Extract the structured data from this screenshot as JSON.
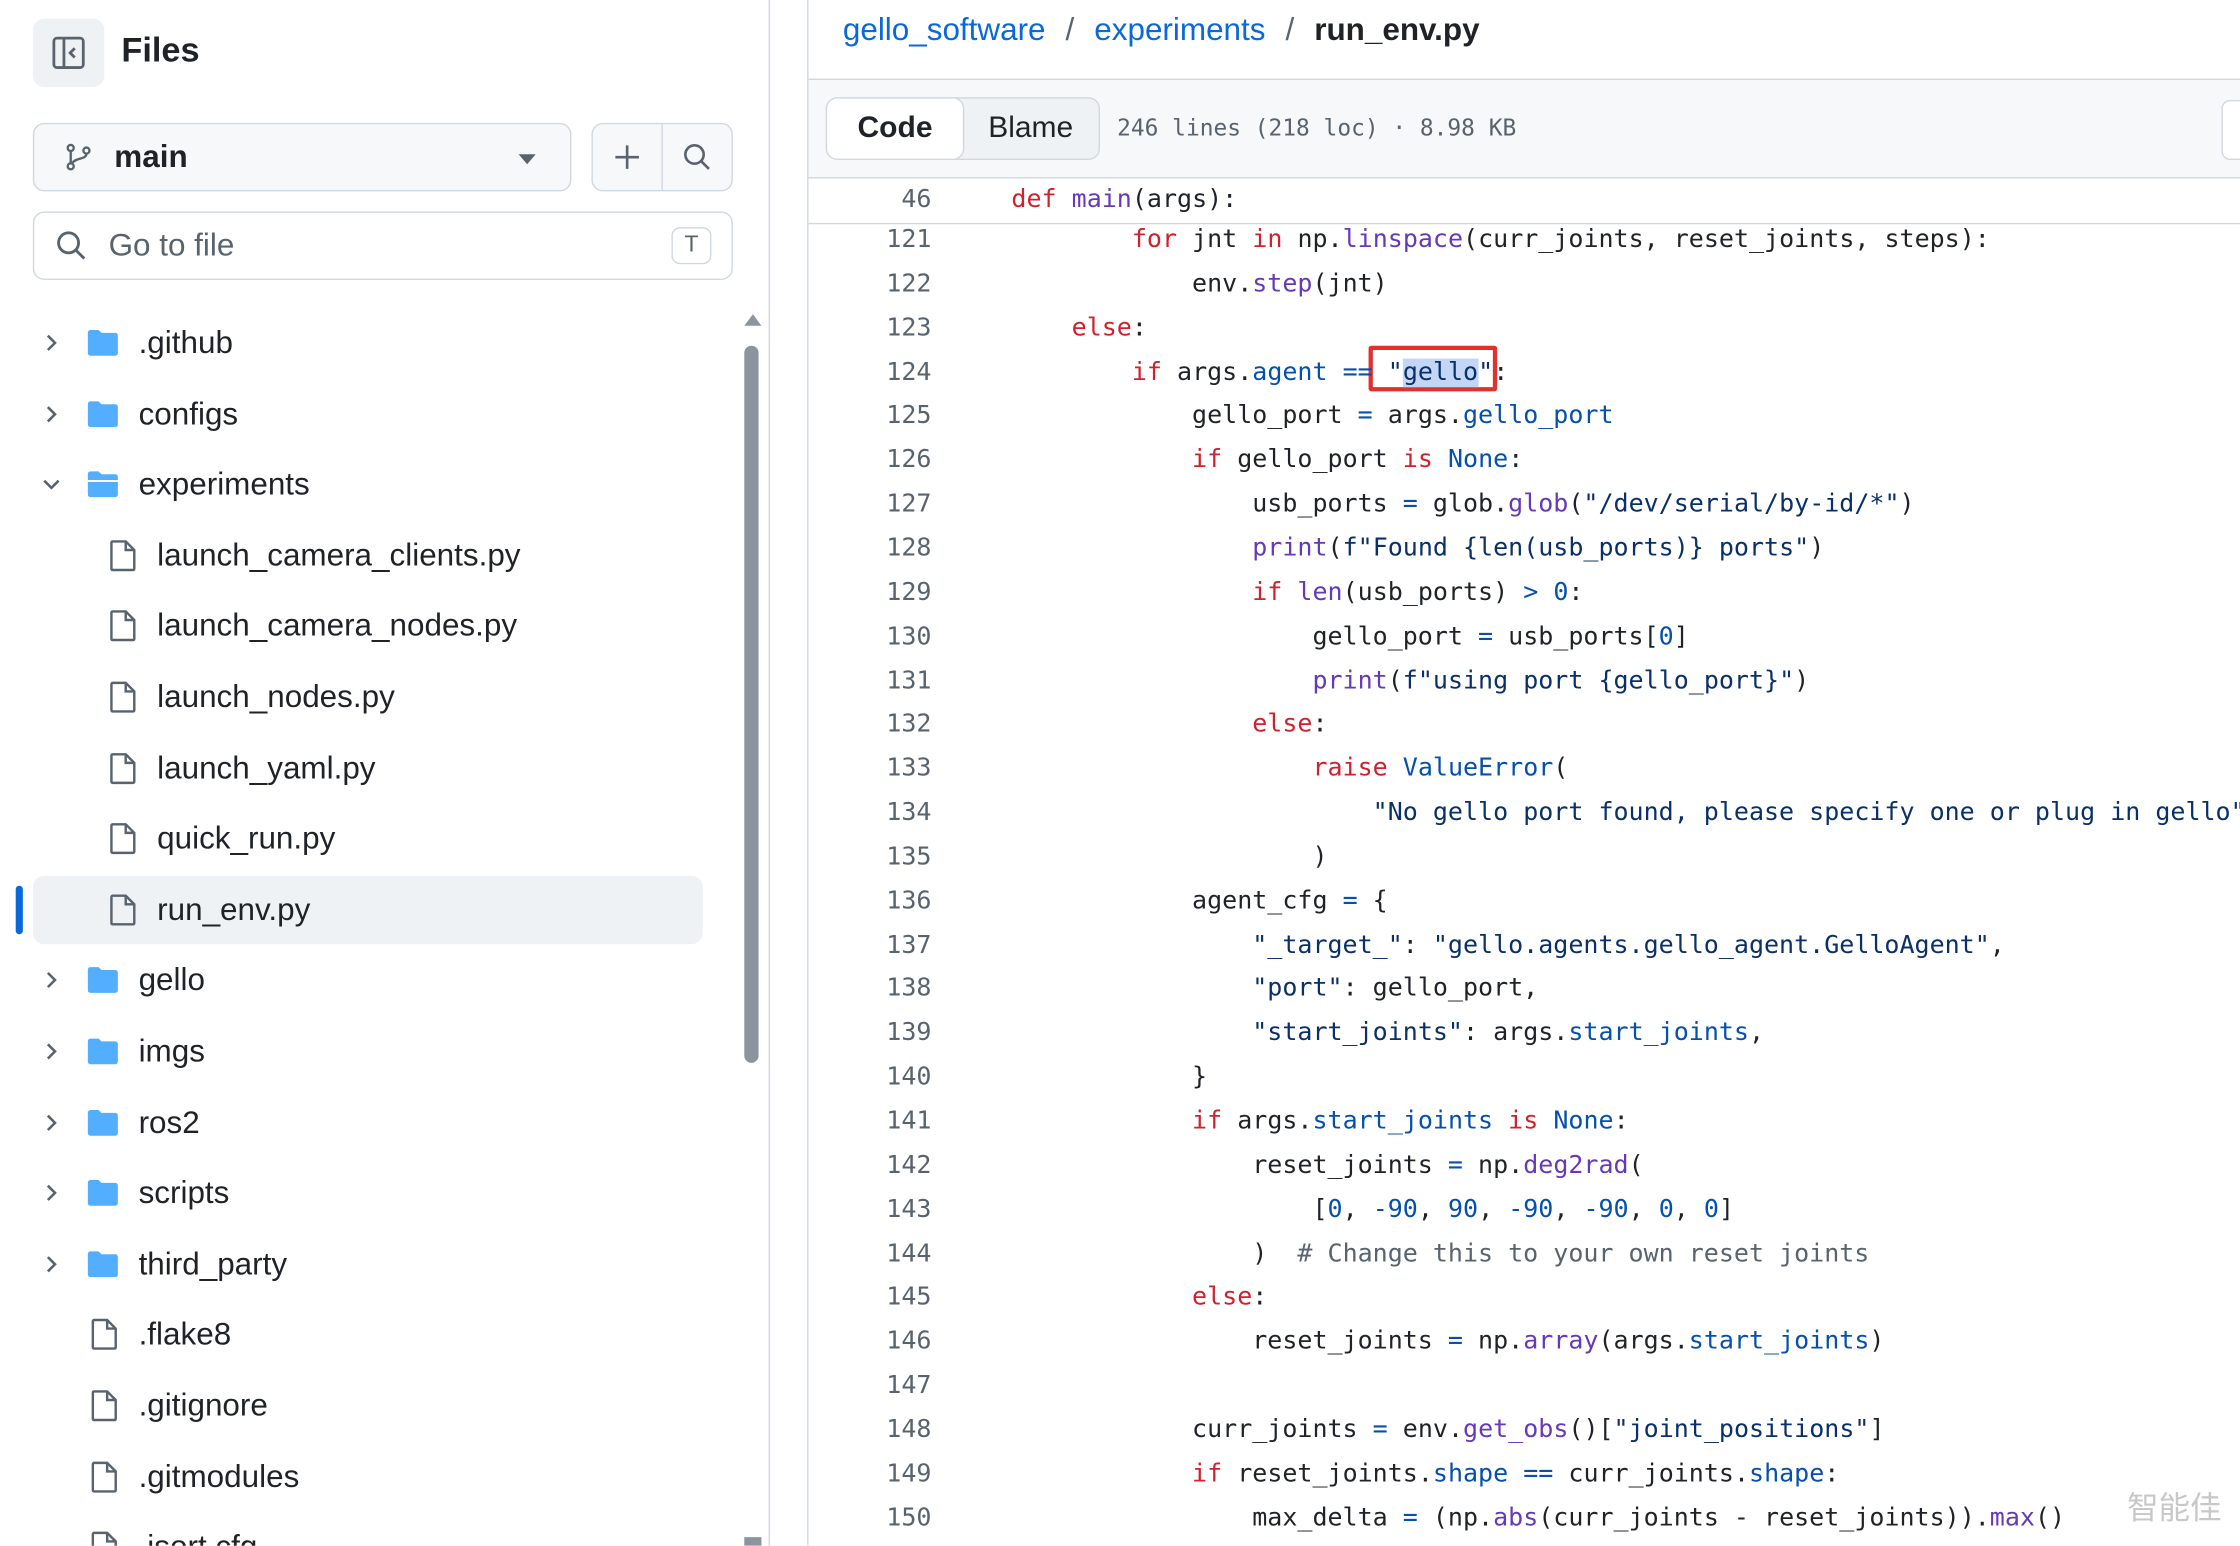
{
  "sidebar": {
    "title": "Files",
    "branch": "main",
    "goto_placeholder": "Go to file",
    "goto_shortcut": "T",
    "items": [
      {
        "label": ".github",
        "type": "folder",
        "expanded": false,
        "depth": 0
      },
      {
        "label": "configs",
        "type": "folder",
        "expanded": false,
        "depth": 0
      },
      {
        "label": "experiments",
        "type": "folder",
        "expanded": true,
        "depth": 0
      },
      {
        "label": "launch_camera_clients.py",
        "type": "file",
        "depth": 1
      },
      {
        "label": "launch_camera_nodes.py",
        "type": "file",
        "depth": 1
      },
      {
        "label": "launch_nodes.py",
        "type": "file",
        "depth": 1
      },
      {
        "label": "launch_yaml.py",
        "type": "file",
        "depth": 1
      },
      {
        "label": "quick_run.py",
        "type": "file",
        "depth": 1
      },
      {
        "label": "run_env.py",
        "type": "file",
        "depth": 1,
        "active": true
      },
      {
        "label": "gello",
        "type": "folder",
        "expanded": false,
        "depth": 0
      },
      {
        "label": "imgs",
        "type": "folder",
        "expanded": false,
        "depth": 0
      },
      {
        "label": "ros2",
        "type": "folder",
        "expanded": false,
        "depth": 0
      },
      {
        "label": "scripts",
        "type": "folder",
        "expanded": false,
        "depth": 0
      },
      {
        "label": "third_party",
        "type": "folder",
        "expanded": false,
        "depth": 0
      },
      {
        "label": ".flake8",
        "type": "file",
        "depth": 0
      },
      {
        "label": ".gitignore",
        "type": "file",
        "depth": 0
      },
      {
        "label": ".gitmodules",
        "type": "file",
        "depth": 0
      },
      {
        "label": ".isort.cfg",
        "type": "file",
        "depth": 0
      }
    ]
  },
  "breadcrumb": {
    "repo": "gello_software",
    "folder": "experiments",
    "file": "run_env.py",
    "separator": "/"
  },
  "toolbar": {
    "code_tab": "Code",
    "blame_tab": "Blame",
    "file_info": "246 lines (218 loc) · 8.98 KB"
  },
  "code": {
    "sticky": {
      "num": "46",
      "text": "def main(args):"
    },
    "lines": [
      {
        "num": "121",
        "text": "        for jnt in np.linspace(curr_joints, reset_joints, steps):"
      },
      {
        "num": "122",
        "text": "            env.step(jnt)"
      },
      {
        "num": "123",
        "text": "    else:"
      },
      {
        "num": "124",
        "text": "        if args.agent == \"gello\":"
      },
      {
        "num": "125",
        "text": "            gello_port = args.gello_port"
      },
      {
        "num": "126",
        "text": "            if gello_port is None:"
      },
      {
        "num": "127",
        "text": "                usb_ports = glob.glob(\"/dev/serial/by-id/*\")"
      },
      {
        "num": "128",
        "text": "                print(f\"Found {len(usb_ports)} ports\")"
      },
      {
        "num": "129",
        "text": "                if len(usb_ports) > 0:"
      },
      {
        "num": "130",
        "text": "                    gello_port = usb_ports[0]"
      },
      {
        "num": "131",
        "text": "                    print(f\"using port {gello_port}\")"
      },
      {
        "num": "132",
        "text": "                else:"
      },
      {
        "num": "133",
        "text": "                    raise ValueError("
      },
      {
        "num": "134",
        "text": "                        \"No gello port found, please specify one or plug in gello\""
      },
      {
        "num": "135",
        "text": "                    )"
      },
      {
        "num": "136",
        "text": "            agent_cfg = {"
      },
      {
        "num": "137",
        "text": "                \"_target_\": \"gello.agents.gello_agent.GelloAgent\","
      },
      {
        "num": "138",
        "text": "                \"port\": gello_port,"
      },
      {
        "num": "139",
        "text": "                \"start_joints\": args.start_joints,"
      },
      {
        "num": "140",
        "text": "            }"
      },
      {
        "num": "141",
        "text": "            if args.start_joints is None:"
      },
      {
        "num": "142",
        "text": "                reset_joints = np.deg2rad("
      },
      {
        "num": "143",
        "text": "                    [0, -90, 90, -90, -90, 0, 0]"
      },
      {
        "num": "144",
        "text": "                )  # Change this to your own reset joints"
      },
      {
        "num": "145",
        "text": "            else:"
      },
      {
        "num": "146",
        "text": "                reset_joints = np.array(args.start_joints)"
      },
      {
        "num": "147",
        "text": ""
      },
      {
        "num": "148",
        "text": "            curr_joints = env.get_obs()[\"joint_positions\"]"
      },
      {
        "num": "149",
        "text": "            if reset_joints.shape == curr_joints.shape:"
      },
      {
        "num": "150",
        "text": "                max_delta = (np.abs(curr_joints - reset_joints)).max()"
      }
    ]
  },
  "watermark": "智能佳",
  "colors": {
    "link": "#0969da",
    "keyword": "#cf222e",
    "function": "#6639ba",
    "attribute": "#0550ae",
    "string": "#0a3069",
    "highlight_box": "#e0312f"
  }
}
